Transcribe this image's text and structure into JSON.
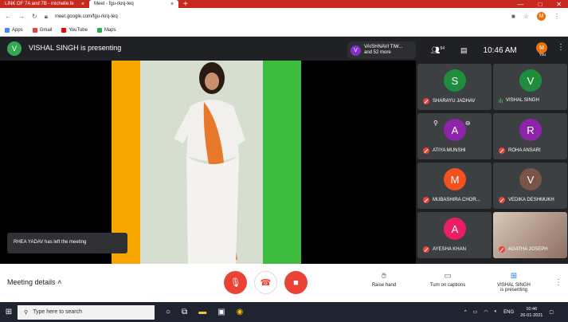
{
  "browser": {
    "tabs": [
      {
        "title": "LINK OF 7A and 7B - michelle.fe",
        "close": "×"
      },
      {
        "title": "Meet - fgu-rkrq-teq",
        "close": "×"
      }
    ],
    "new_tab": "+",
    "window_controls": [
      "—",
      "□",
      "✕"
    ],
    "url": "meet.google.com/fgu-rkrq-teq",
    "profile_initial": "M",
    "bookmarks": [
      {
        "label": "Apps",
        "color": "#4285f4"
      },
      {
        "label": "Gmail",
        "color": "#ea4335"
      },
      {
        "label": "YouTube",
        "color": "#ff0000"
      },
      {
        "label": "Maps",
        "color": "#34a853"
      }
    ]
  },
  "meeting": {
    "presenter_initial": "V",
    "presenter_banner": "VISHAL SINGH is presenting",
    "chip_initial": "V",
    "chip_line1": "VAISHNAVI TIW...",
    "chip_line2": "and 52 more",
    "participant_count": "54",
    "time": "10:46 AM",
    "you_initial": "M",
    "you_label": "You",
    "toast": "RHEA YADAV has left the meeting"
  },
  "participants": [
    {
      "initial": "S",
      "name": "SHARAYU JADHAV",
      "color": "#1e8e3e",
      "muted": true
    },
    {
      "initial": "V",
      "name": "VISHAL SINGH",
      "color": "#1e8e3e",
      "muted": false
    },
    {
      "initial": "A",
      "name": "ATIYA MUNSHI",
      "color": "#8e24aa",
      "muted": true
    },
    {
      "initial": "R",
      "name": "ROHA ANSARI",
      "color": "#8e24aa",
      "muted": true
    },
    {
      "initial": "M",
      "name": "MUBASHIRA CHOR...",
      "color": "#f4511e",
      "muted": true
    },
    {
      "initial": "V",
      "name": "VEDIKA DESHMUKH",
      "color": "#795548",
      "muted": true
    },
    {
      "initial": "A",
      "name": "AYESHA KHAN",
      "color": "#e91e63",
      "muted": true
    },
    {
      "initial": "",
      "name": "AGATHA JOSEPH",
      "color": "#8d6e63",
      "muted": true
    }
  ],
  "controls": {
    "meeting_details": "Meeting details",
    "raise_hand": "Raise hand",
    "captions": "Turn on captions",
    "presenting_line1": "VISHAL SINGH",
    "presenting_line2": "is presenting"
  },
  "taskbar": {
    "search_placeholder": "Type here to search",
    "lang": "ENG",
    "time": "10:46",
    "date": "26-01-2021"
  }
}
